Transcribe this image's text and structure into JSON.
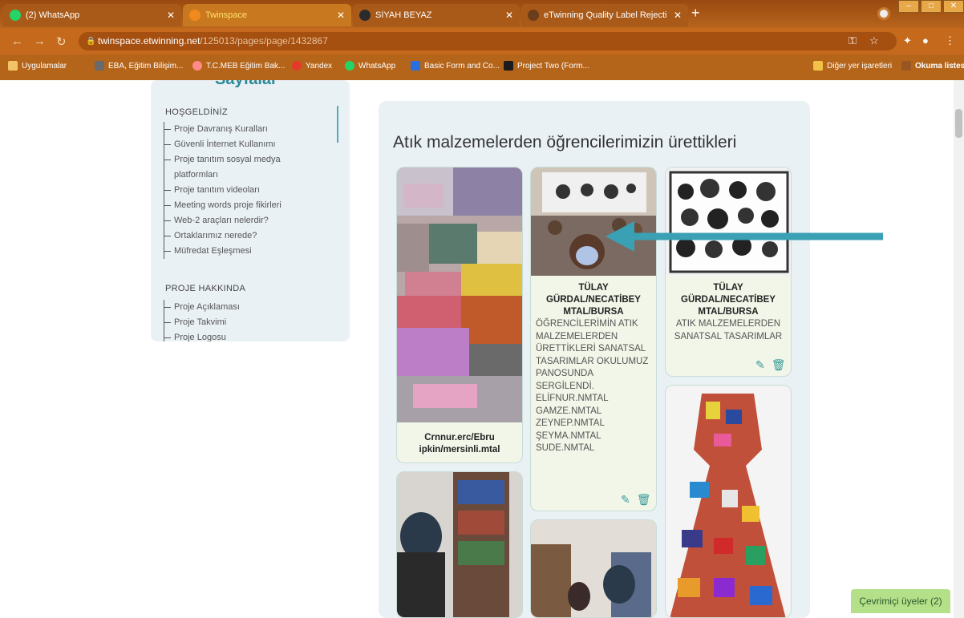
{
  "tabs": [
    {
      "title": "(2) WhatsApp",
      "fav": "#25d366"
    },
    {
      "title": "Twinspace",
      "fav": "#f08a1e"
    },
    {
      "title": "SİYAH BEYAZ",
      "fav": "#2b2b2b"
    },
    {
      "title": "eTwinning Quality Label Rejecti",
      "fav": "#6a3d1b"
    }
  ],
  "url": {
    "host": "twinspace.etwinning.net",
    "path": "/125013/pages/page/1432867"
  },
  "bookmarks": [
    {
      "label": "Uygulamalar",
      "color": "#f3c467"
    },
    {
      "label": "EBA, Eğitim Bilişim...",
      "color": "#6a6a6a"
    },
    {
      "label": "T.C.MEB Eğitim Bak...",
      "color": "#ff8a8a"
    },
    {
      "label": "Yandex",
      "color": "#e53a2b"
    },
    {
      "label": "WhatsApp",
      "color": "#25d366"
    },
    {
      "label": "Basic Form and Co...",
      "color": "#2a6fdb"
    },
    {
      "label": "Project Two (Form...",
      "color": "#1b1b1b"
    },
    {
      "label": "Diğer yer işaretleri",
      "color": "#f2c14a"
    },
    {
      "label": "Okuma listesi",
      "color": "#9a5520"
    }
  ],
  "sidebar": {
    "heading_cut": "Sayfalar",
    "sections": [
      {
        "title": "HOŞGELDİNİZ",
        "items": [
          "Proje Davranış Kuralları",
          "Güvenli İnternet Kullanımı",
          "Proje tanıtım sosyal medya platformları",
          "Proje tanıtım videoları",
          "Meeting words proje fikirleri",
          "Web-2 araçları nelerdir?",
          "Ortaklarımız nerede?",
          "Müfredat Eşleşmesi"
        ]
      },
      {
        "title": "PROJE HAKKINDA",
        "items": [
          "Proje Açıklaması",
          "Proje Takvimi",
          "Proje Logosu"
        ]
      }
    ]
  },
  "main": {
    "title": "Atık malzemelerden öğrencilerimizin ürettikleri",
    "cards": [
      {
        "author": "Crnnur.erc/Ebru ipkin/mersinli.mtal",
        "desc": ""
      },
      {
        "author": "TÜLAY GÜRDAL/NECATİBEY MTAL/BURSA",
        "desc": "ÖĞRENCİLERİMİN ATIK MALZEMELERDEN ÜRETTİKLERİ SANATSAL TASARIMLAR OKULUMUZ PANOSUNDA SERGİLENDİ. ELİFNUR.NMTAL GAMZE.NMTAL ZEYNEP.NMTAL ŞEYMA.NMTAL SUDE.NMTAL"
      },
      {
        "author": "TÜLAY GÜRDAL/NECATİBEY MTAL/BURSA",
        "desc": "ATIK MALZEMELERDEN SANATSAL TASARIMLAR"
      }
    ]
  },
  "online_users": "Çevrimiçi üyeler (2)",
  "colors": {
    "accent": "#3aa0b4",
    "card_bg": "#f1f6e8",
    "tab_bg": "#b7641d"
  }
}
